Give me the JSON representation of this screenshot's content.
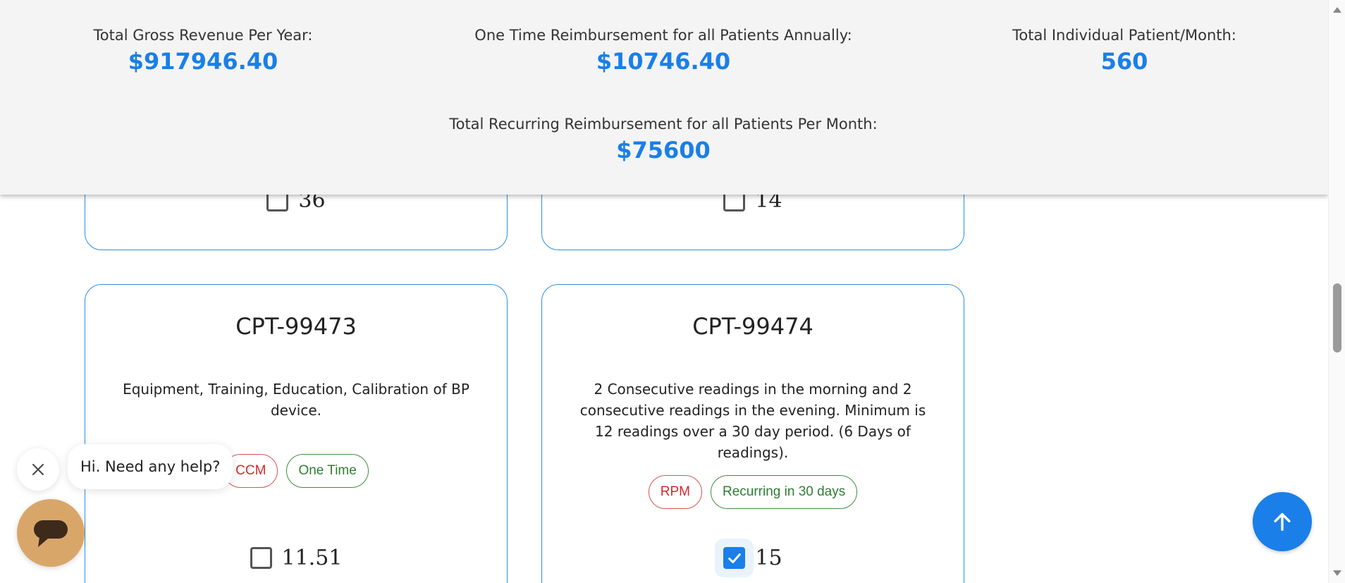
{
  "summary": {
    "gross_revenue": {
      "label": "Total Gross Revenue Per Year:",
      "value": "$917946.40"
    },
    "one_time": {
      "label": "One Time Reimbursement for all Patients Annually:",
      "value": "$10746.40"
    },
    "patients_month": {
      "label": "Total Individual Patient/Month:",
      "value": "560"
    },
    "recurring": {
      "label": "Total Recurring Reimbursement for all Patients Per Month:",
      "value": "$75600"
    }
  },
  "top_cards": [
    {
      "value": "36",
      "checked": false
    },
    {
      "value": "14",
      "checked": false
    }
  ],
  "cards": [
    {
      "title": "CPT-99473",
      "description": "Equipment, Training, Education, Calibration of BP device.",
      "tags": [
        {
          "label": "CCM",
          "color": "red"
        },
        {
          "label": "One Time",
          "color": "green"
        }
      ],
      "value": "11.51",
      "checked": false
    },
    {
      "title": "CPT-99474",
      "description": "2 Consecutive readings in the morning and 2 consecutive readings in the evening. Minimum is 12 readings over a 30 day period. (6 Days of readings).",
      "tags": [
        {
          "label": "RPM",
          "color": "red"
        },
        {
          "label": "Recurring in 30 days",
          "color": "green"
        }
      ],
      "value": "15",
      "checked": true
    }
  ],
  "chat": {
    "message": "Hi. Need any help?",
    "close_icon": "close-icon",
    "launcher_icon": "chat-bubble-icon"
  },
  "back_to_top_icon": "arrow-up-icon",
  "colors": {
    "accent": "#1a7fe8",
    "card_border": "#2f8fdc",
    "tag_red": "#d02a2a",
    "tag_green": "#2e7d32",
    "panel_bg": "#f4f4f4",
    "launcher": "#d9a66a"
  }
}
